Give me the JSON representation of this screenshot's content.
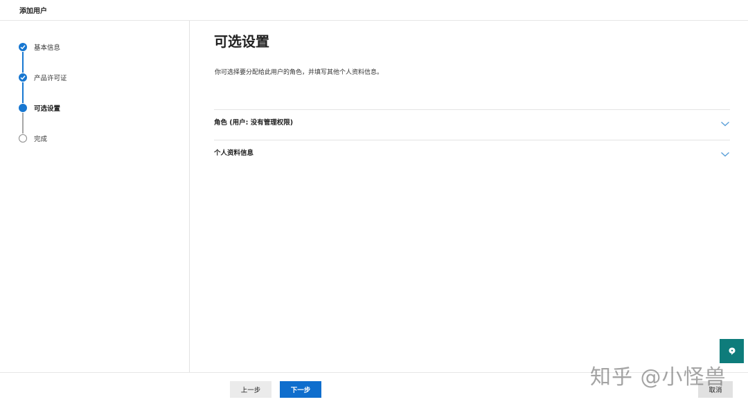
{
  "window": {
    "title": "添加用户"
  },
  "steps": [
    {
      "label": "基本信息",
      "state": "done"
    },
    {
      "label": "产品许可证",
      "state": "done"
    },
    {
      "label": "可选设置",
      "state": "current"
    },
    {
      "label": "完成",
      "state": "todo"
    }
  ],
  "main": {
    "heading": "可选设置",
    "description": "你可选择要分配给此用户的角色，并填写其他个人资料信息。",
    "sections": [
      {
        "label": "角色 (用户: 没有管理权限)",
        "icon": "chevron-down-icon"
      },
      {
        "label": "个人资料信息",
        "icon": "chevron-down-icon"
      }
    ]
  },
  "footer": {
    "back_label": "上一步",
    "next_label": "下一步",
    "cancel_label": "取消"
  },
  "help": {
    "icon": "help-chat-icon"
  },
  "watermark": {
    "text": "知乎 @小怪兽"
  },
  "colors": {
    "accent": "#0f6ecd",
    "step_blue": "#1777d1",
    "help_teal": "#0e7c7b",
    "chevron": "#5a9fd8"
  }
}
